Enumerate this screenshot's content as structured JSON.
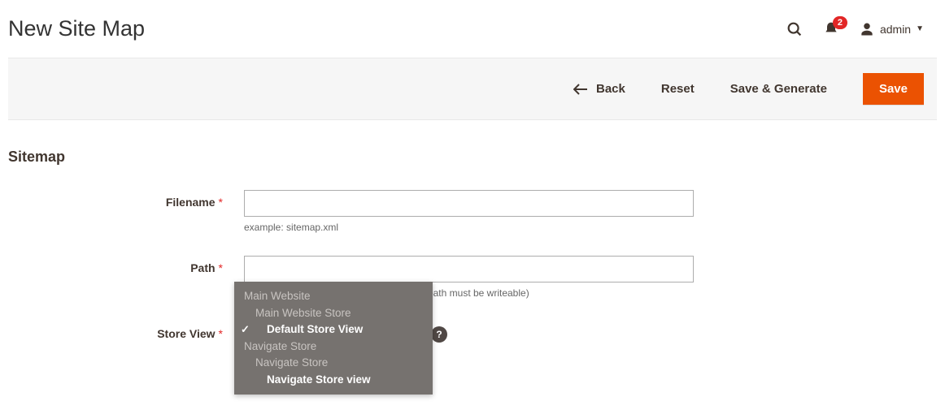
{
  "page": {
    "title": "New Site Map"
  },
  "header": {
    "notification_count": "2",
    "username": "admin"
  },
  "actions": {
    "back": "Back",
    "reset": "Reset",
    "save_generate": "Save & Generate",
    "save": "Save"
  },
  "section": {
    "title": "Sitemap"
  },
  "form": {
    "filename": {
      "label": "Filename",
      "value": "",
      "hint": "example: sitemap.xml"
    },
    "path": {
      "label": "Path",
      "value": "",
      "hint": "example: \"/media/sitemap/\" for base path (path must be writeable)"
    },
    "store_view": {
      "label": "Store View"
    }
  },
  "dropdown": {
    "w1": "Main Website",
    "s1": "Main Website Store",
    "v1": "Default Store View",
    "w2": "Navigate Store",
    "s2": "Navigate Store",
    "v2": "Navigate Store view"
  }
}
